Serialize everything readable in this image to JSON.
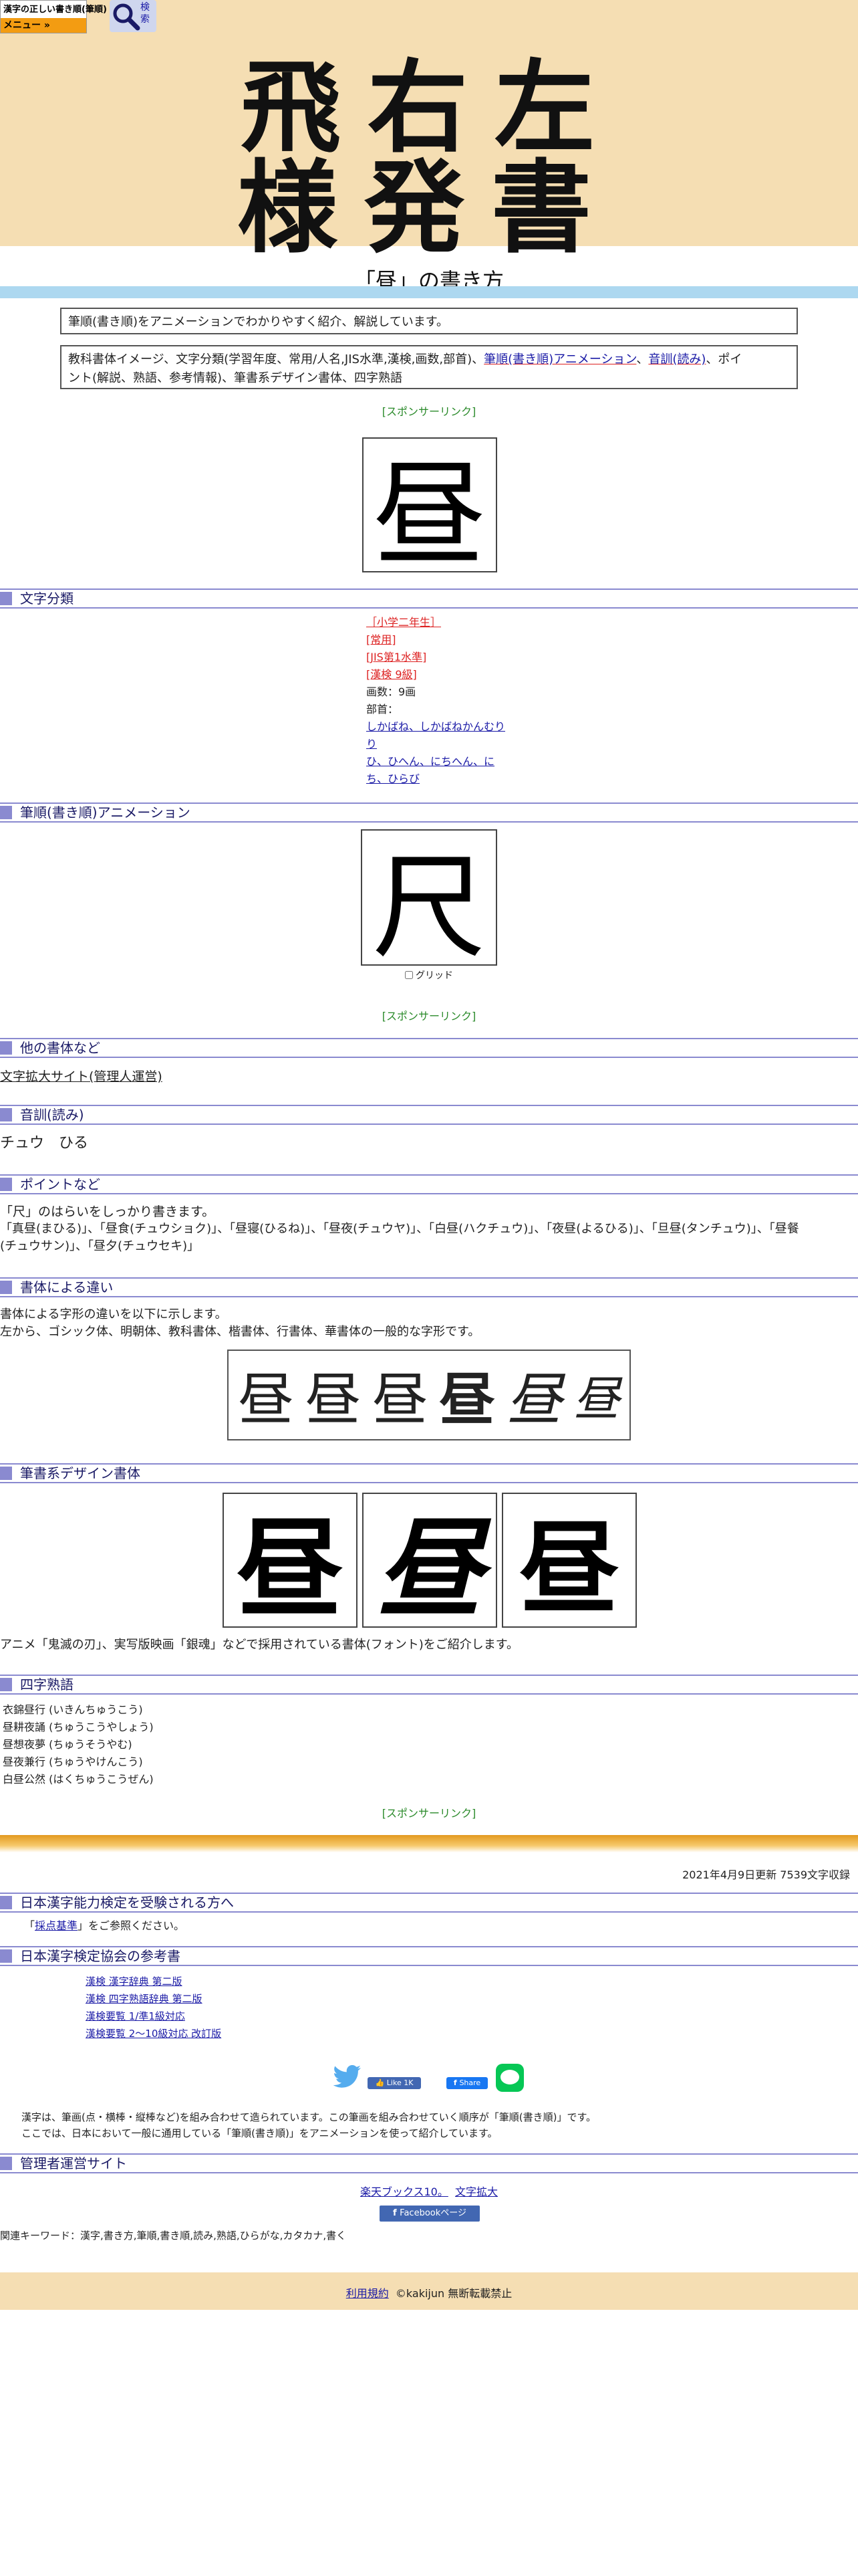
{
  "header": {
    "site_name": "漢字の正しい書き順(筆順)",
    "menu_label": "メニュー »",
    "search_label": "検索",
    "title_row1": "飛右左",
    "title_row2": "様発書"
  },
  "page": {
    "title": "「昼」の書き方",
    "intro": "筆順(書き順)をアニメーションでわかりやすく紹介、解説しています。",
    "toc_prefix": "教科書体イメージ、文字分類(学習年度、常用/人名,JIS水準,漢検,画数,部首)、",
    "toc_link1": "筆順(書き順)アニメーション",
    "toc_sep": "、",
    "toc_link2": "音訓(読み)",
    "toc_suffix": "、ポイ",
    "toc_line2": "ント(解説、熟語、参考情報)、筆書系デザイン書体、四字熟語",
    "sponsor": "[スポンサーリンク]",
    "main_kanji": "昼"
  },
  "sections": {
    "classification": "文字分類",
    "animation": "筆順(書き順)アニメーション",
    "other_fonts": "他の書体など",
    "reading": "音訓(読み)",
    "points": "ポイントなど",
    "font_diff": "書体による違い",
    "brush_fonts": "筆書系デザイン書体",
    "yoji": "四字熟語",
    "kentei": "日本漢字能力検定を受験される方へ",
    "kentei_refs": "日本漢字検定協会の参考書",
    "admin": "管理者運営サイト"
  },
  "classification": {
    "grade": "［小学二年生］",
    "joyo": "[常用]",
    "jis": "[JIS第1水準]",
    "kanken": "[漢検 9級]",
    "strokes": "画数：9画",
    "radical_label": "部首：",
    "radical1": "しかばね、しかばねかんむり",
    "radical1b": "り",
    "radical2": "ひ、ひへん、にちへん、に",
    "radical2b": "ち、ひらび"
  },
  "animation": {
    "char": "尺",
    "grid_label": "グリッド"
  },
  "other_fonts": {
    "link": "文字拡大サイト(管理人運営)"
  },
  "reading": {
    "text": "チュウ　ひる"
  },
  "points": {
    "line1": "「尺」のはらいをしっかり書きます。",
    "line2": "「真昼(まひる)」、「昼食(チュウショク)」、「昼寝(ひるね)」、「昼夜(チュウヤ)」、「白昼(ハクチュウ)」、「夜昼(よるひる)」、「旦昼(タンチュウ)」、「昼餐",
    "line3": "(チュウサン)」、「昼夕(チュウセキ)」"
  },
  "font_diff": {
    "line1": "書体による字形の違いを以下に示します。",
    "line2": "左から、ゴシック体、明朝体、教科書体、楷書体、行書体、華書体の一般的な字形です。",
    "samples": [
      "昼",
      "昼",
      "昼",
      "昼",
      "昼",
      "昼"
    ]
  },
  "brush": {
    "samples": [
      "昼",
      "昼",
      "昼"
    ],
    "caption": "アニメ「鬼滅の刃」、実写版映画「銀魂」などで採用されている書体(フォント)をご紹介します。"
  },
  "yoji": {
    "items": [
      "衣錦昼行 (いきんちゅうこう)",
      "昼耕夜誦 (ちゅうこうやしょう)",
      "昼想夜夢 (ちゅうそうやむ)",
      "昼夜兼行 (ちゅうやけんこう)",
      "白昼公然 (はくちゅうこうぜん)"
    ]
  },
  "updated": "2021年4月9日更新 7539文字収録",
  "kentei": {
    "prefix": "「",
    "link": "採点基準",
    "suffix": "」をご参照ください。"
  },
  "refs": {
    "items": [
      "漢検 漢字辞典 第二版",
      "漢検 四字熟語辞典 第二版",
      "漢検要覧 1/準1級対応",
      "漢検要覧 2～10級対応 改訂版"
    ]
  },
  "social": {
    "like": "Like 1K",
    "share": "Share"
  },
  "description": {
    "line1": "漢字は、筆画(点・横棒・縦棒など)を組み合わせて造られています。この筆画を組み合わせていく順序が「筆順(書き順)」です。",
    "line2": "ここでは、日本において一般に通用している「筆順(書き順)」をアニメーションを使って紹介しています。"
  },
  "admin": {
    "link1": "楽天ブックス10。",
    "link2": "文字拡大",
    "fb_page": "Facebookページ"
  },
  "keywords": "関連キーワード：漢字,書き方,筆順,書き順,読み,熟語,ひらがな,カタカナ,書く",
  "footer": {
    "terms": "利用規約",
    "copyright": "©kakijun 無断転載禁止"
  },
  "colors": {
    "header_bg": "#f5deb3",
    "title_band": "#add8f0",
    "section_accent": "#8a8ad0",
    "sponsor_green": "#2a8a2a",
    "orange": "#f39c12"
  }
}
